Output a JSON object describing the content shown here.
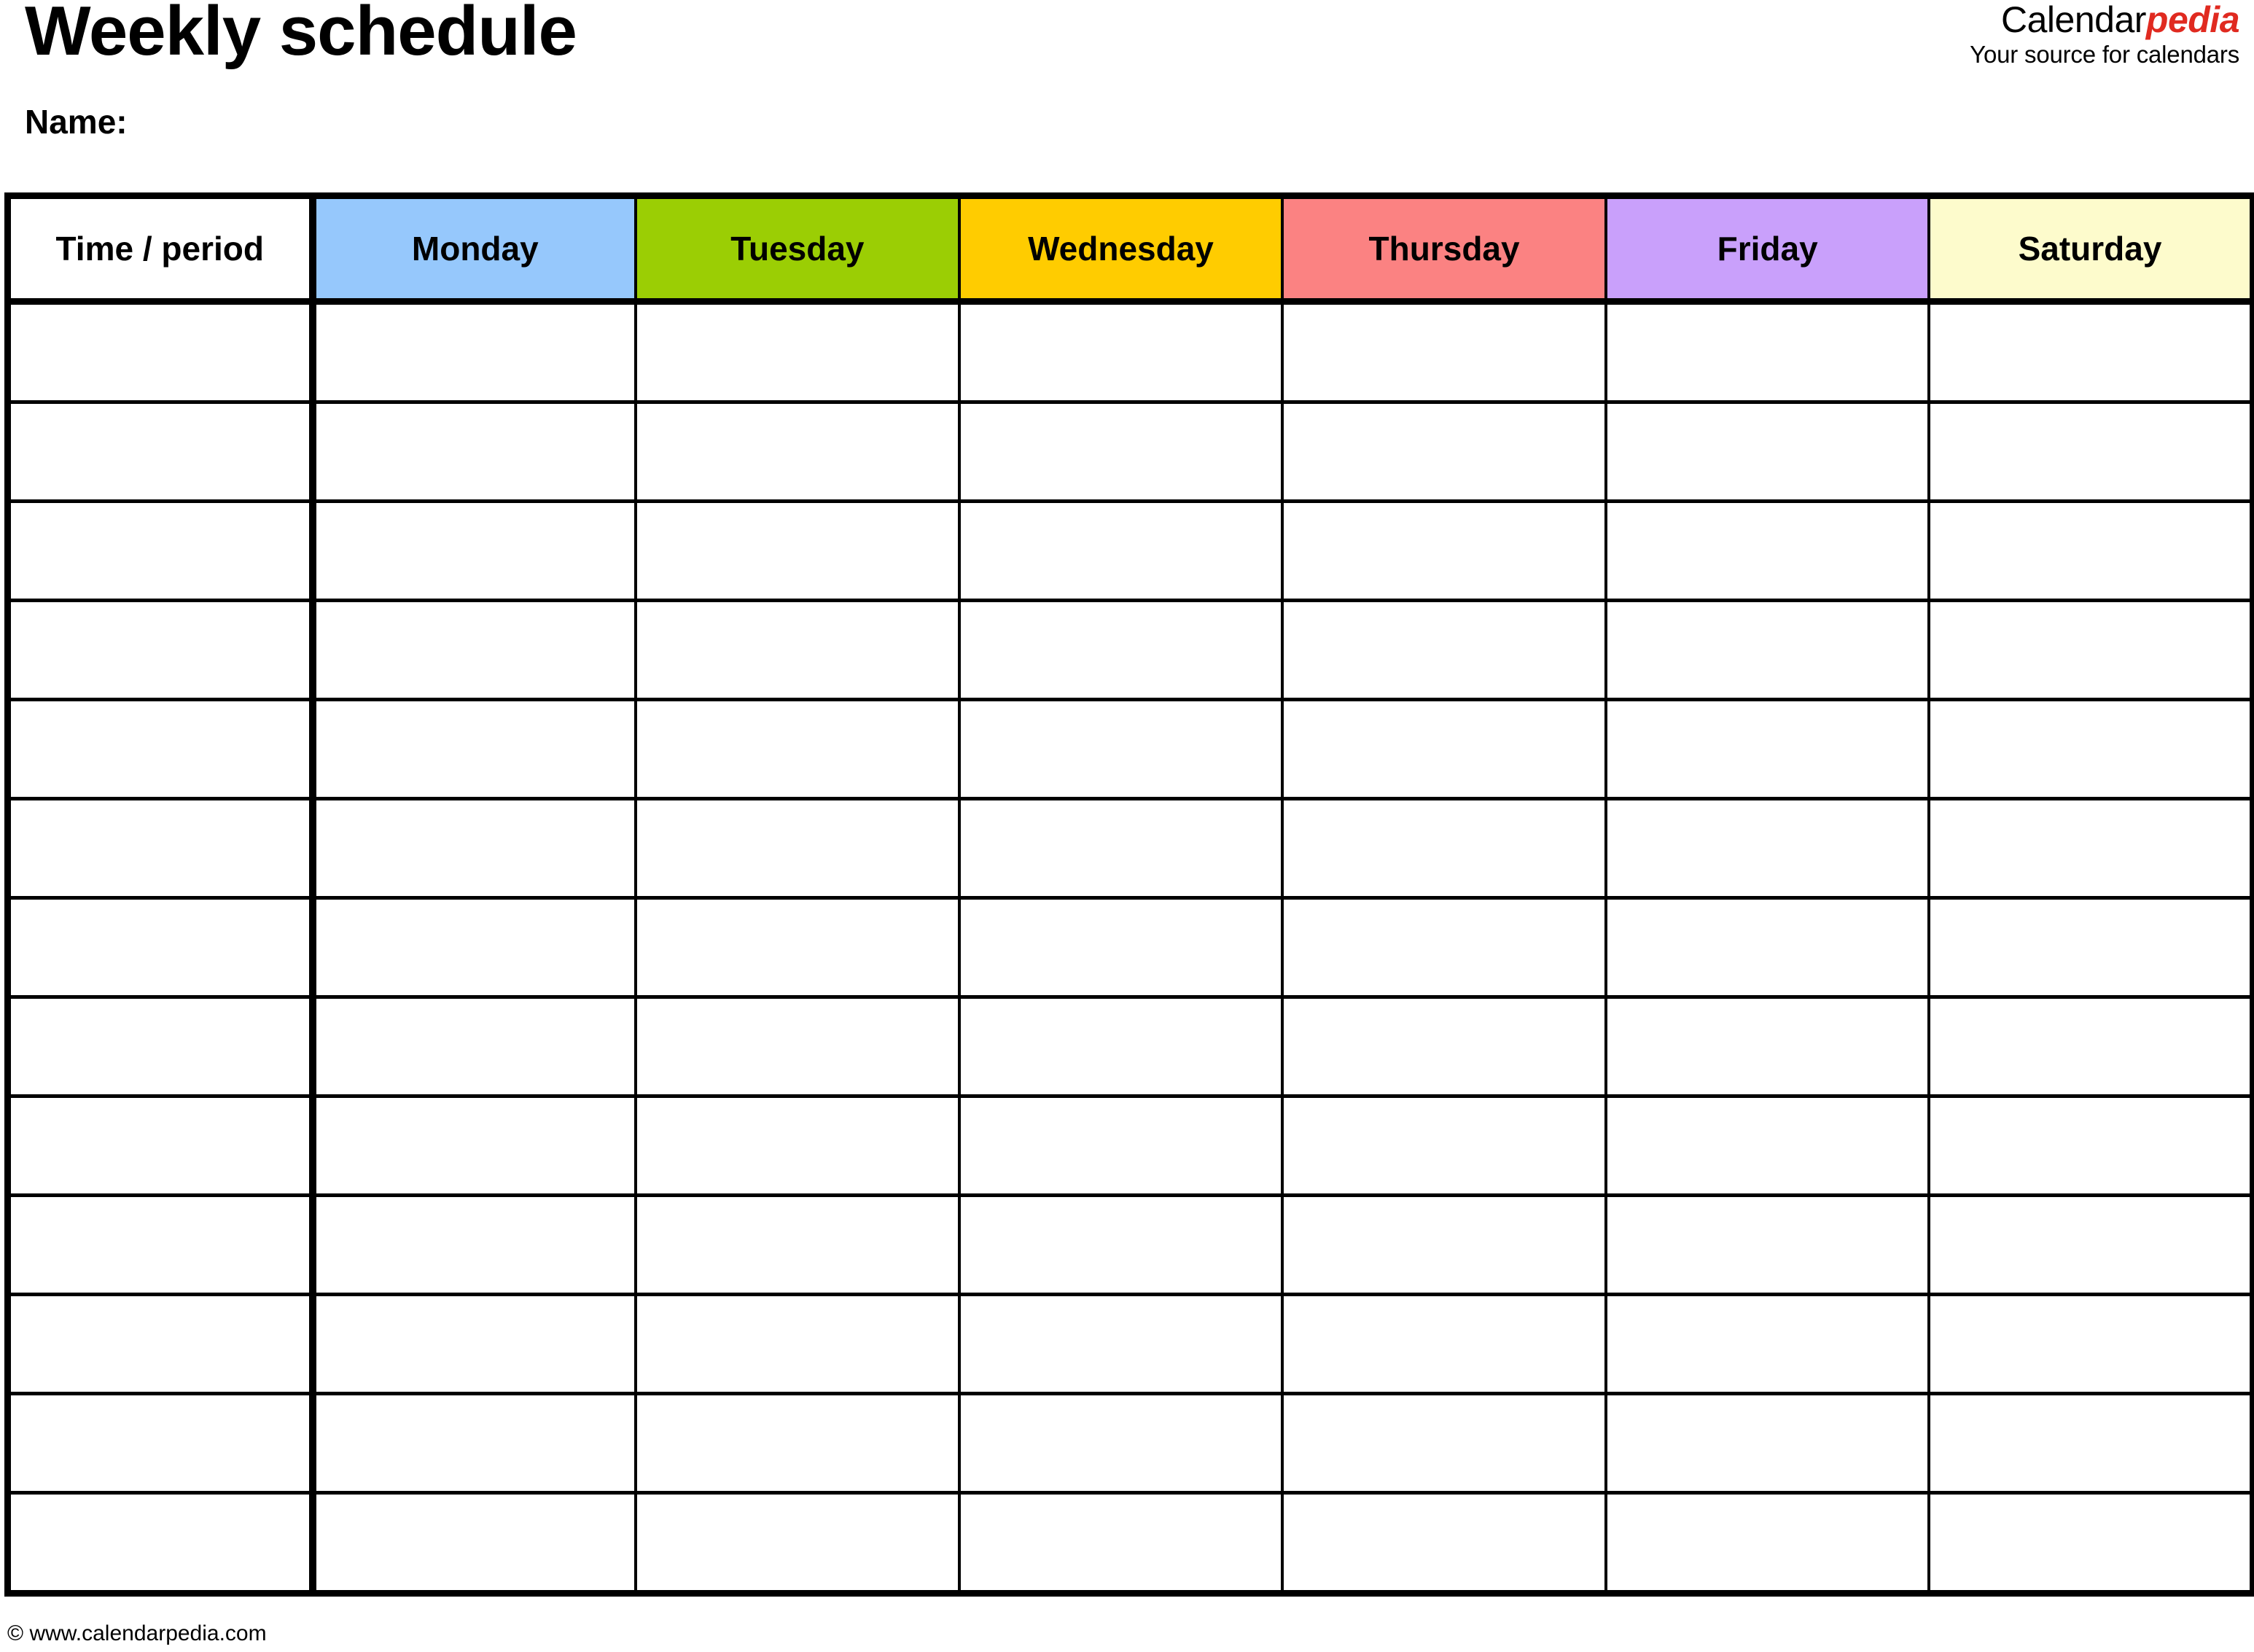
{
  "header": {
    "title": "Weekly schedule",
    "name_label": "Name:",
    "brand": {
      "logo_part_a": "Calendar",
      "logo_part_b": "pedia",
      "tagline": "Your source for calendars",
      "accent_color": "#e02a20"
    }
  },
  "table": {
    "columns": [
      {
        "label": "Time / period",
        "color": "#ffffff"
      },
      {
        "label": "Monday",
        "color": "#96c8fc"
      },
      {
        "label": "Tuesday",
        "color": "#9bce04"
      },
      {
        "label": "Wednesday",
        "color": "#ffcc00"
      },
      {
        "label": "Thursday",
        "color": "#fb8282"
      },
      {
        "label": "Friday",
        "color": "#c9a0fb"
      },
      {
        "label": "Saturday",
        "color": "#fdfbcc"
      }
    ],
    "row_count": 13,
    "rows": [
      [
        "",
        "",
        "",
        "",
        "",
        "",
        ""
      ],
      [
        "",
        "",
        "",
        "",
        "",
        "",
        ""
      ],
      [
        "",
        "",
        "",
        "",
        "",
        "",
        ""
      ],
      [
        "",
        "",
        "",
        "",
        "",
        "",
        ""
      ],
      [
        "",
        "",
        "",
        "",
        "",
        "",
        ""
      ],
      [
        "",
        "",
        "",
        "",
        "",
        "",
        ""
      ],
      [
        "",
        "",
        "",
        "",
        "",
        "",
        ""
      ],
      [
        "",
        "",
        "",
        "",
        "",
        "",
        ""
      ],
      [
        "",
        "",
        "",
        "",
        "",
        "",
        ""
      ],
      [
        "",
        "",
        "",
        "",
        "",
        "",
        ""
      ],
      [
        "",
        "",
        "",
        "",
        "",
        "",
        ""
      ],
      [
        "",
        "",
        "",
        "",
        "",
        "",
        ""
      ],
      [
        "",
        "",
        "",
        "",
        "",
        "",
        ""
      ]
    ]
  },
  "footer": {
    "copyright": "© www.calendarpedia.com"
  }
}
